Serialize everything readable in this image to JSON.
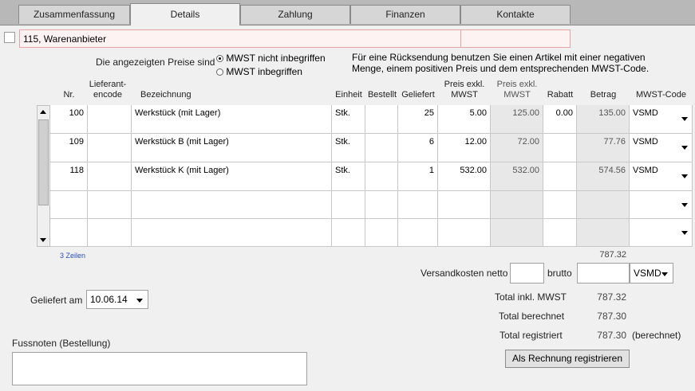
{
  "tabs": [
    {
      "label": "Zusammenfassung",
      "active": false
    },
    {
      "label": "Details",
      "active": true
    },
    {
      "label": "Zahlung",
      "active": false
    },
    {
      "label": "Finanzen",
      "active": false
    },
    {
      "label": "Kontakte",
      "active": false
    }
  ],
  "supplier": {
    "value": "115, Warenanbieter"
  },
  "price_mode": {
    "label": "Die angezeigten Preise sind",
    "options": [
      {
        "label": "MWST nicht inbegriffen",
        "selected": true
      },
      {
        "label": "MWST inbegriffen",
        "selected": false
      }
    ]
  },
  "return_note": {
    "line1": "Für eine Rücksendung benutzen Sie einen Artikel mit einer negativen",
    "line2": "Menge, einem positiven Preis und dem entsprechenden MWST-Code."
  },
  "table": {
    "headers": {
      "nr": "Nr.",
      "lief1": "Lieferant-",
      "lief2": "encode",
      "bez": "Bezeichnung",
      "einheit": "Einheit",
      "bestellt": "Bestellt",
      "geliefert": "Geliefert",
      "preis1a": "Preis exkl.",
      "preis1b": "MWST",
      "preis2a": "Preis exkl.",
      "preis2b": "MWST",
      "rabatt": "Rabatt",
      "betrag": "Betrag",
      "mwst": "MWST-Code"
    },
    "rows": [
      {
        "nr": "100",
        "lief": "",
        "bez": "Werkstück (mit Lager)",
        "einheit": "Stk.",
        "bestellt": "",
        "geliefert": "25",
        "preis": "5.00",
        "preis2": "125.00",
        "rabatt": "0.00",
        "betrag": "135.00",
        "mwst": "VSMD"
      },
      {
        "nr": "109",
        "lief": "",
        "bez": "Werkstück B (mit Lager)",
        "einheit": "Stk.",
        "bestellt": "",
        "geliefert": "6",
        "preis": "12.00",
        "preis2": "72.00",
        "rabatt": "",
        "betrag": "77.76",
        "mwst": "VSMD"
      },
      {
        "nr": "118",
        "lief": "",
        "bez": "Werkstück K (mit Lager)",
        "einheit": "Stk.",
        "bestellt": "",
        "geliefert": "1",
        "preis": "532.00",
        "preis2": "532.00",
        "rabatt": "",
        "betrag": "574.56",
        "mwst": "VSMD"
      }
    ],
    "row_count": "3 Zeilen",
    "sum": "787.32"
  },
  "shipping": {
    "label_netto": "Versandkosten netto",
    "netto": "",
    "label_brutto": "brutto",
    "brutto": "",
    "code": "VSMD"
  },
  "delivered": {
    "label": "Geliefert am",
    "date": "10.06.14"
  },
  "totals": {
    "incl_label": "Total inkl. MWST",
    "incl": "787.32",
    "charged_label": "Total berechnet",
    "charged": "787.30",
    "registered_label": "Total registriert",
    "registered": "787.30",
    "registered_note": "(berechnet)"
  },
  "footnotes": {
    "label": "Fussnoten (Bestellung)",
    "value": ""
  },
  "register_button": "Als Rechnung registrieren"
}
